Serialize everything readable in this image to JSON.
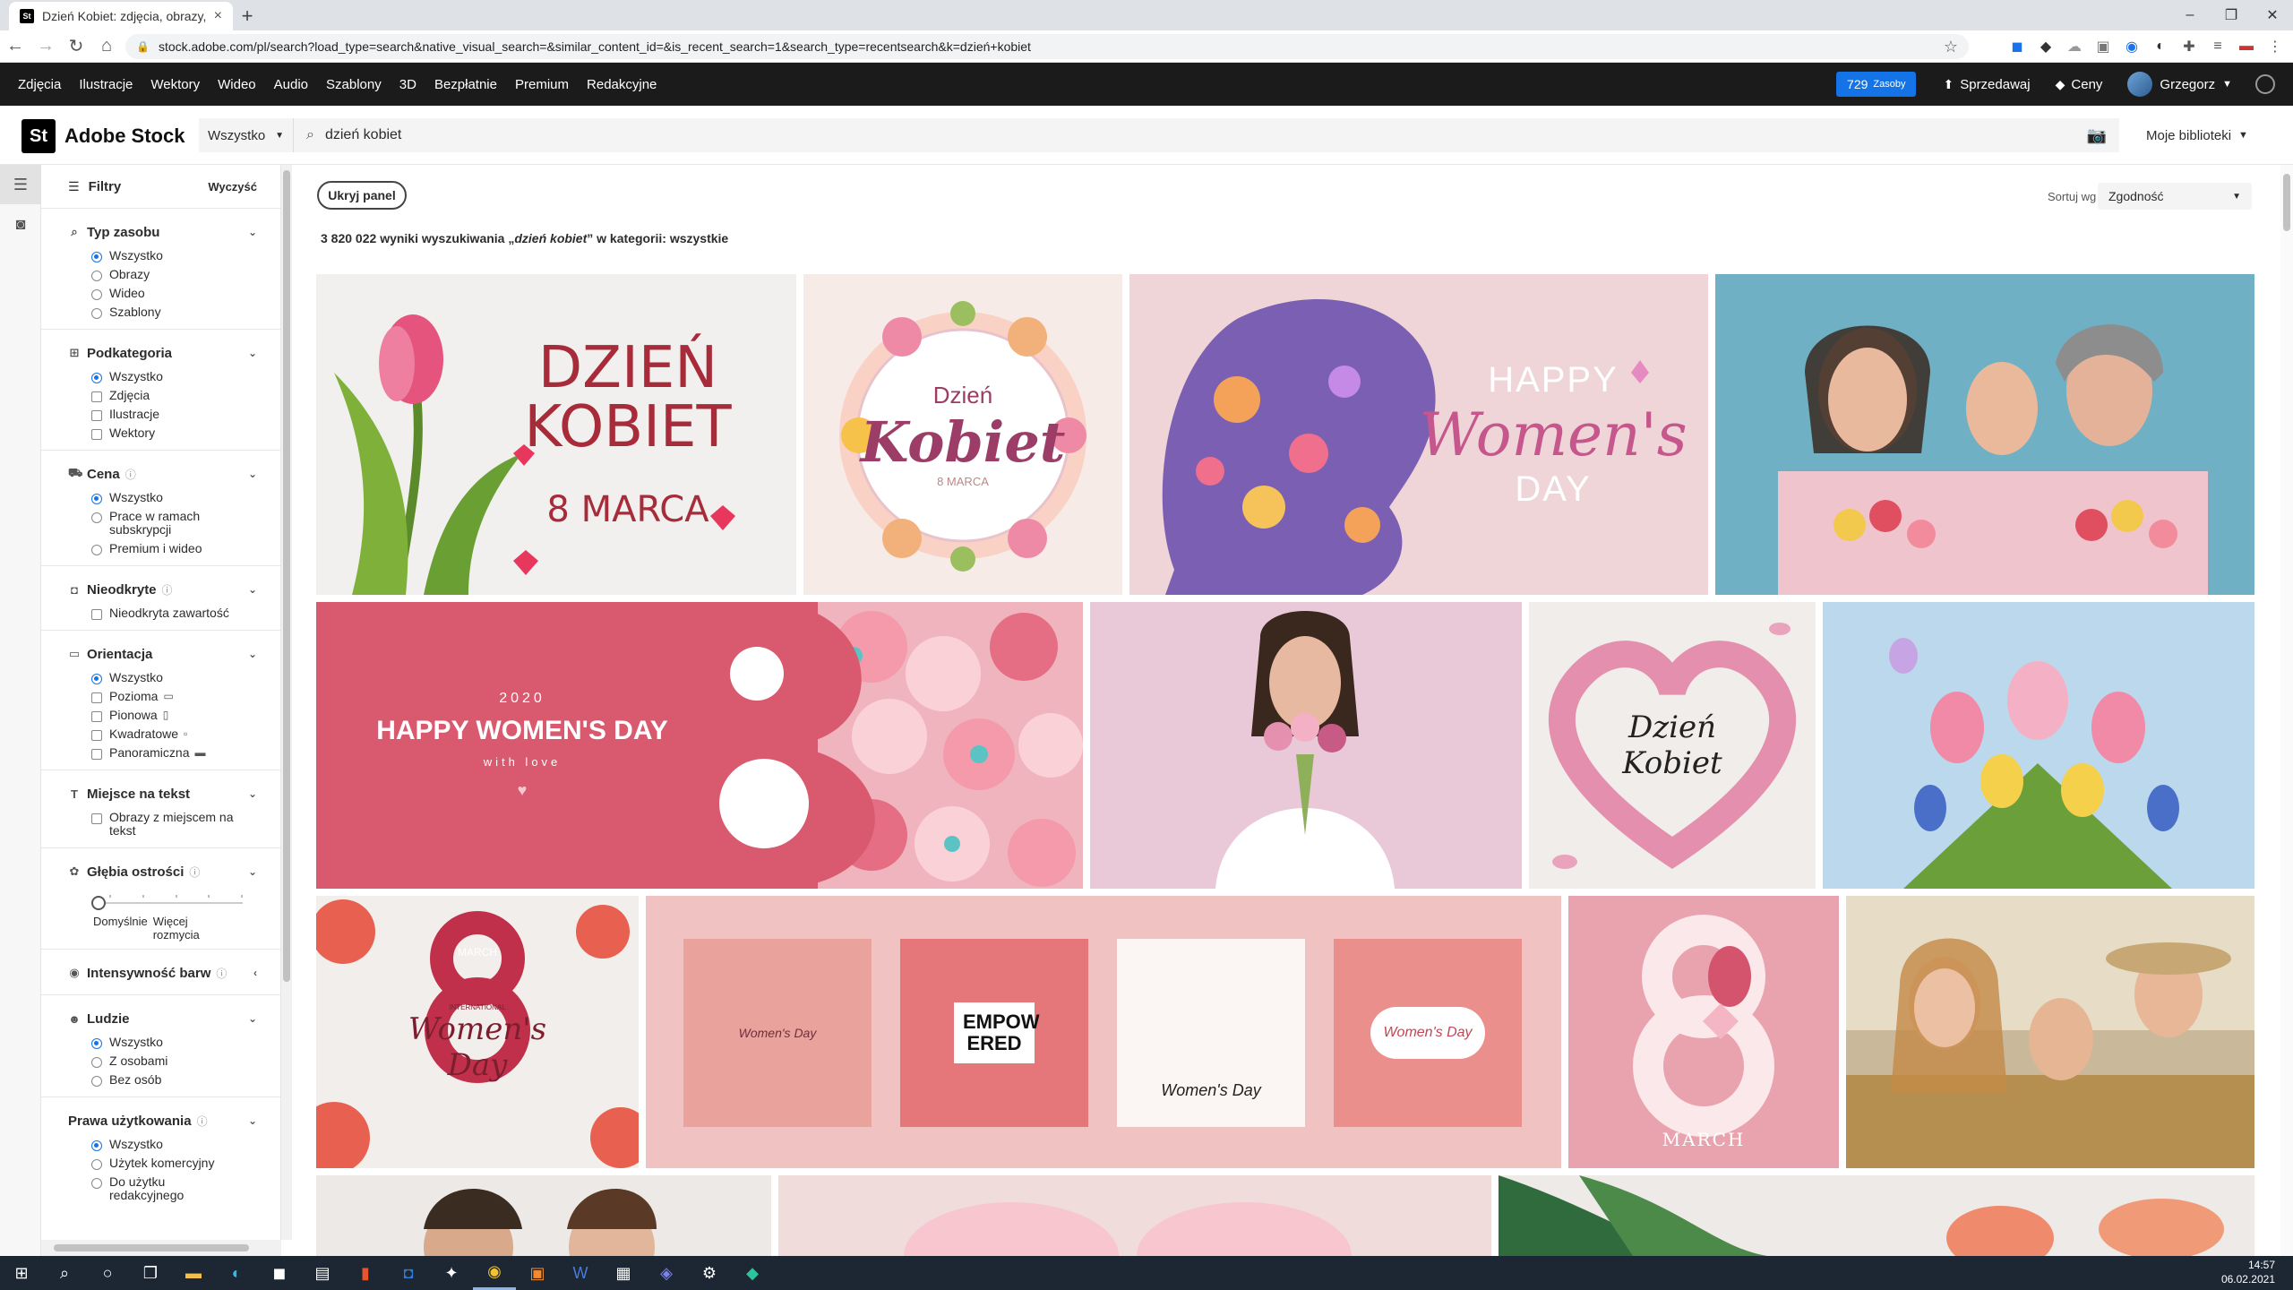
{
  "browser": {
    "tab_title": "Dzień Kobiet: zdjęcia, obrazy, gra",
    "tab_favicon": "St",
    "url": "stock.adobe.com/pl/search?load_type=search&native_visual_search=&similar_content_id=&is_recent_search=1&search_type=recentsearch&k=dzień+kobiet"
  },
  "sitenav": {
    "categories": [
      "Zdjęcia",
      "Ilustracje",
      "Wektory",
      "Wideo",
      "Audio",
      "Szablony",
      "3D",
      "Bezpłatnie",
      "Premium",
      "Redakcyjne"
    ],
    "credits_count": "729",
    "credits_label": "Zasoby",
    "sell": "Sprzedawaj",
    "pricing": "Ceny",
    "user": "Grzegorz"
  },
  "search": {
    "logo_mark": "St",
    "logo_name": "Adobe Stock",
    "type": "Wszystko",
    "query": "dzień kobiet",
    "libraries": "Moje biblioteki"
  },
  "filters": {
    "title": "Filtry",
    "clear": "Wyczyść",
    "asset_type": {
      "title": "Typ zasobu",
      "options": [
        "Wszystko",
        "Obrazy",
        "Wideo",
        "Szablony"
      ]
    },
    "subcategory": {
      "title": "Podkategoria",
      "options": [
        "Wszystko",
        "Zdjęcia",
        "Ilustracje",
        "Wektory"
      ]
    },
    "price": {
      "title": "Cena",
      "options": [
        "Wszystko",
        "Prace w ramach subskrypcji",
        "Premium i wideo"
      ]
    },
    "undiscovered": {
      "title": "Nieodkryte",
      "options": [
        "Nieodkryta zawartość"
      ]
    },
    "orientation": {
      "title": "Orientacja",
      "options": [
        "Wszystko",
        "Pozioma",
        "Pionowa",
        "Kwadratowe",
        "Panoramiczna"
      ]
    },
    "copy_space": {
      "title": "Miejsce na tekst",
      "options": [
        "Obrazy z miejscem na tekst"
      ]
    },
    "depth": {
      "title": "Głębia ostrości",
      "left": "Domyślnie",
      "right": "Więcej rozmycia"
    },
    "vivid": {
      "title": "Intensywność barw"
    },
    "people": {
      "title": "Ludzie",
      "options": [
        "Wszystko",
        "Z osobami",
        "Bez osób"
      ]
    },
    "license": {
      "title": "Prawa użytkowania",
      "options": [
        "Wszystko",
        "Użytek komercyjny",
        "Do użytku redakcyjnego"
      ]
    }
  },
  "main": {
    "hide_panel": "Ukryj panel",
    "sort_label": "Sortuj wg",
    "sort_value": "Zgodność",
    "results_count": "3 820 022",
    "results_pre": "wyniki wyszukiwania „",
    "results_query": "dzień kobiet",
    "results_post": "” w kategorii: wszystkie"
  },
  "tiles": {
    "t1": {
      "line1": "DZIEŃ",
      "line2": "KOBIET",
      "line3": "8 MARCA"
    },
    "t2": {
      "line1": "Dzień",
      "line2": "Kobiet",
      "line3": "8 MARCA"
    },
    "t3": {
      "line1": "HAPPY",
      "line2": "Women's",
      "line3": "DAY"
    },
    "t5": {
      "line1": "2020",
      "line2": "HAPPY WOMEN'S DAY",
      "line3": "with love"
    },
    "t7": {
      "line1": "Dzień",
      "line2": "Kobiet"
    },
    "t9": {
      "line1": "MARCH",
      "line2": "Women's",
      "line3": "Day",
      "line4": "INTERNATIONAL"
    },
    "t10": {
      "card1": "Women's Day",
      "card2": "EMPOW ERED",
      "card3": "Women's Day",
      "card4": "Women's Day"
    },
    "t11": {
      "line1": "MARCH"
    }
  },
  "taskbar": {
    "time": "14:57",
    "date": "06.02.2021"
  },
  "colors": {
    "accent": "#1473e6",
    "nav_bg": "#1b1b1b",
    "pink": "#e36a7f"
  }
}
